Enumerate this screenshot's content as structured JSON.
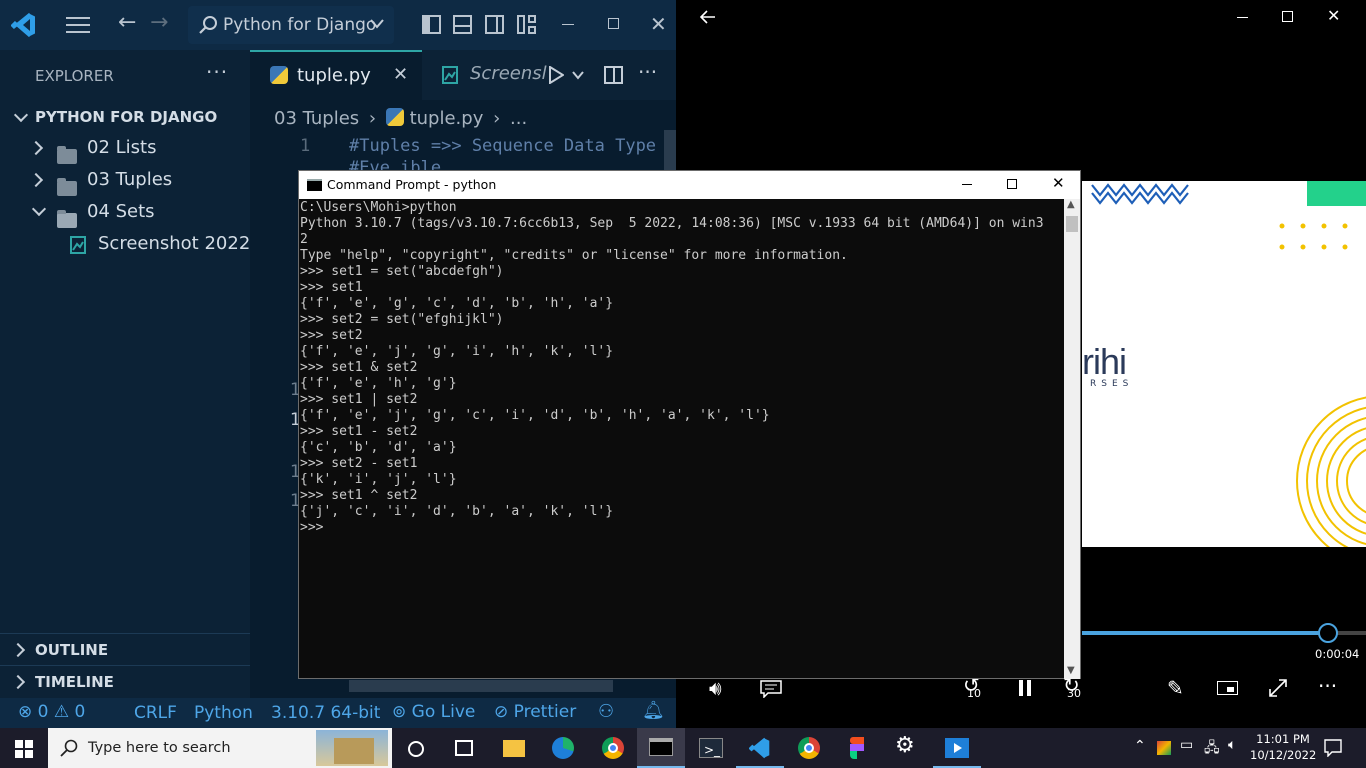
{
  "vscode": {
    "title_search": "Python for Django",
    "explorer_label": "EXPLORER",
    "project_name": "PYTHON FOR DJANGO",
    "tree": [
      {
        "label": "02 Lists"
      },
      {
        "label": "03 Tuples"
      },
      {
        "label": "04 Sets"
      },
      {
        "label": "Screenshot 2022..."
      }
    ],
    "outline_label": "OUTLINE",
    "timeline_label": "TIMELINE",
    "tabs": [
      {
        "label": "tuple.py"
      },
      {
        "label": "Screensl"
      }
    ],
    "breadcrumb": {
      "folder": "03 Tuples",
      "file": "tuple.py",
      "more": "..."
    },
    "code": {
      "line_no": "1",
      "line_text": "#Tuples =>> Sequence Data Type",
      "line2_fragment": "#Eve   ible"
    },
    "gutter": [
      "1",
      "1",
      "1",
      "1"
    ],
    "status": {
      "errors": "0",
      "warnings": "0",
      "eol": "CRLF",
      "language": "Python",
      "interpreter": "3.10.7 64-bit",
      "go_live": "Go Live",
      "prettier": "Prettier"
    }
  },
  "cmd": {
    "title": "Command Prompt - python",
    "icon_label": "C:\\",
    "lines": [
      "C:\\Users\\Mohi>python",
      "Python 3.10.7 (tags/v3.10.7:6cc6b13, Sep  5 2022, 14:08:36) [MSC v.1933 64 bit (AMD64)] on win3",
      "2",
      "Type \"help\", \"copyright\", \"credits\" or \"license\" for more information.",
      ">>> set1 = set(\"abcdefgh\")",
      ">>> set1",
      "{'f', 'e', 'g', 'c', 'd', 'b', 'h', 'a'}",
      ">>> set2 = set(\"efghijkl\")",
      ">>> set2",
      "{'f', 'e', 'j', 'g', 'i', 'h', 'k', 'l'}",
      ">>> set1 & set2",
      "{'f', 'e', 'h', 'g'}",
      ">>> set1 | set2",
      "{'f', 'e', 'j', 'g', 'c', 'i', 'd', 'b', 'h', 'a', 'k', 'l'}",
      ">>> set1 - set2",
      "{'c', 'b', 'd', 'a'}",
      ">>> set2 - set1",
      "{'k', 'i', 'j', 'l'}",
      ">>> set1 ^ set2",
      "{'j', 'c', 'i', 'd', 'b', 'a', 'k', 'l'}",
      ">>>"
    ]
  },
  "player": {
    "slide_text": "rihi",
    "slide_subtext": "RSES",
    "time": "0:00:04",
    "progress": 0.97,
    "rewind_label": "10",
    "forward_label": "30"
  },
  "taskbar": {
    "search_placeholder": "Type here to search",
    "clock_time": "11:01 PM",
    "clock_date": "10/12/2022"
  },
  "colors": {
    "vscode_bg": "#0a1f33",
    "status_blue": "#4ea6e8",
    "accent_teal": "#2ea5a5",
    "player_accent": "#4aa3df",
    "slide_yellow": "#f2c200",
    "slide_green": "#23d18b",
    "slide_blue": "#1e5fb8"
  }
}
